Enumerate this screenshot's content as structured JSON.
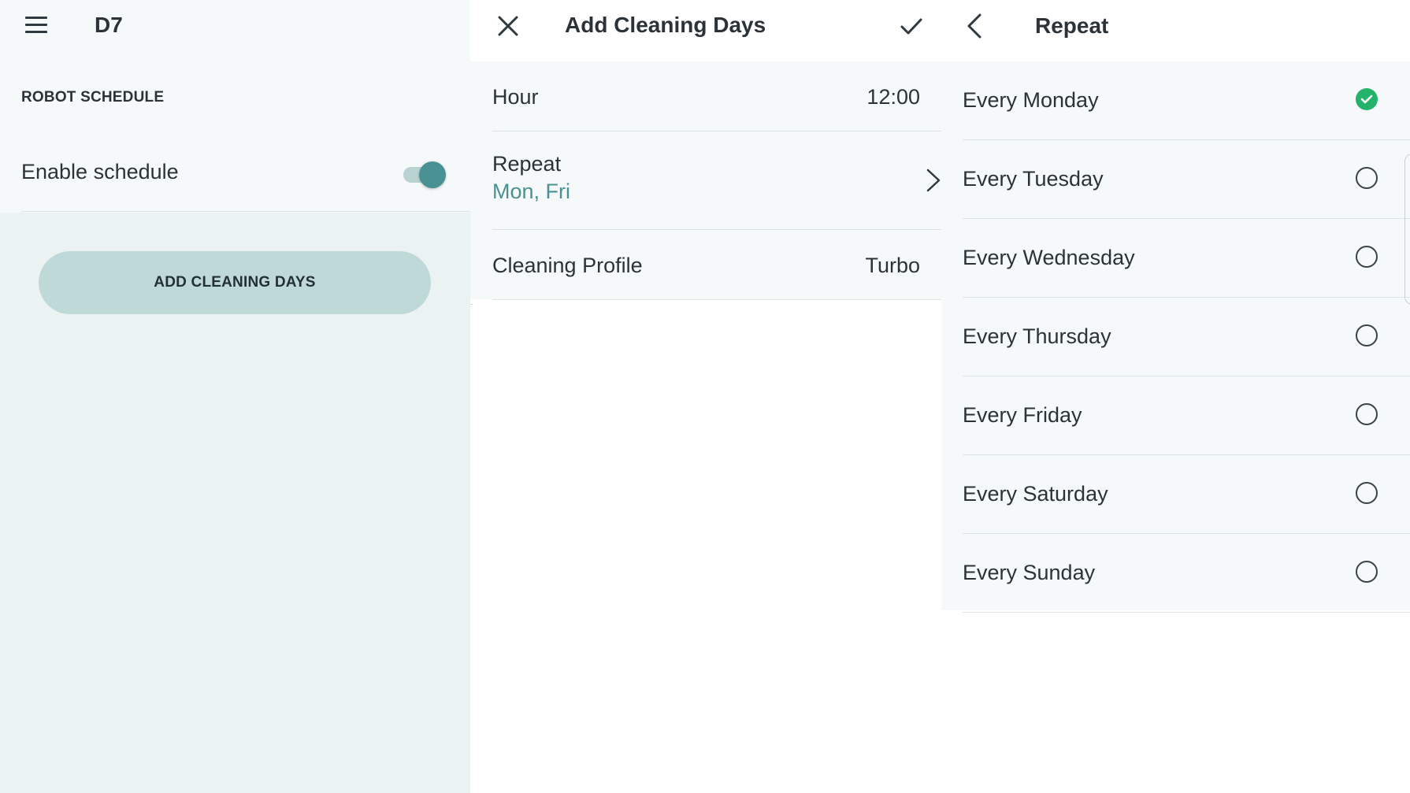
{
  "panel_schedule": {
    "title": "D7",
    "icon": "menu-icon",
    "section_header": "ROBOT SCHEDULE",
    "enable_label": "Enable schedule",
    "enable_on": true,
    "add_button": "ADD CLEANING DAYS"
  },
  "panel_add": {
    "title": "Add Cleaning Days",
    "rows": [
      {
        "label": "Hour",
        "value": "12:00"
      },
      {
        "label": "Repeat",
        "value": "Mon, Fri"
      },
      {
        "label": "Cleaning Profile",
        "value": "Turbo"
      }
    ]
  },
  "panel_repeat": {
    "title": "Repeat",
    "days": [
      {
        "label": "Every Monday",
        "checked": true
      },
      {
        "label": "Every Tuesday",
        "checked": false
      },
      {
        "label": "Every Wednesday",
        "checked": false
      },
      {
        "label": "Every Thursday",
        "checked": false
      },
      {
        "label": "Every Friday",
        "checked": false
      },
      {
        "label": "Every Saturday",
        "checked": false
      },
      {
        "label": "Every Sunday",
        "checked": false
      }
    ]
  },
  "colors": {
    "accent": "#4a9193",
    "check_green": "#25b26b",
    "button_bg": "#bfd9d9"
  }
}
